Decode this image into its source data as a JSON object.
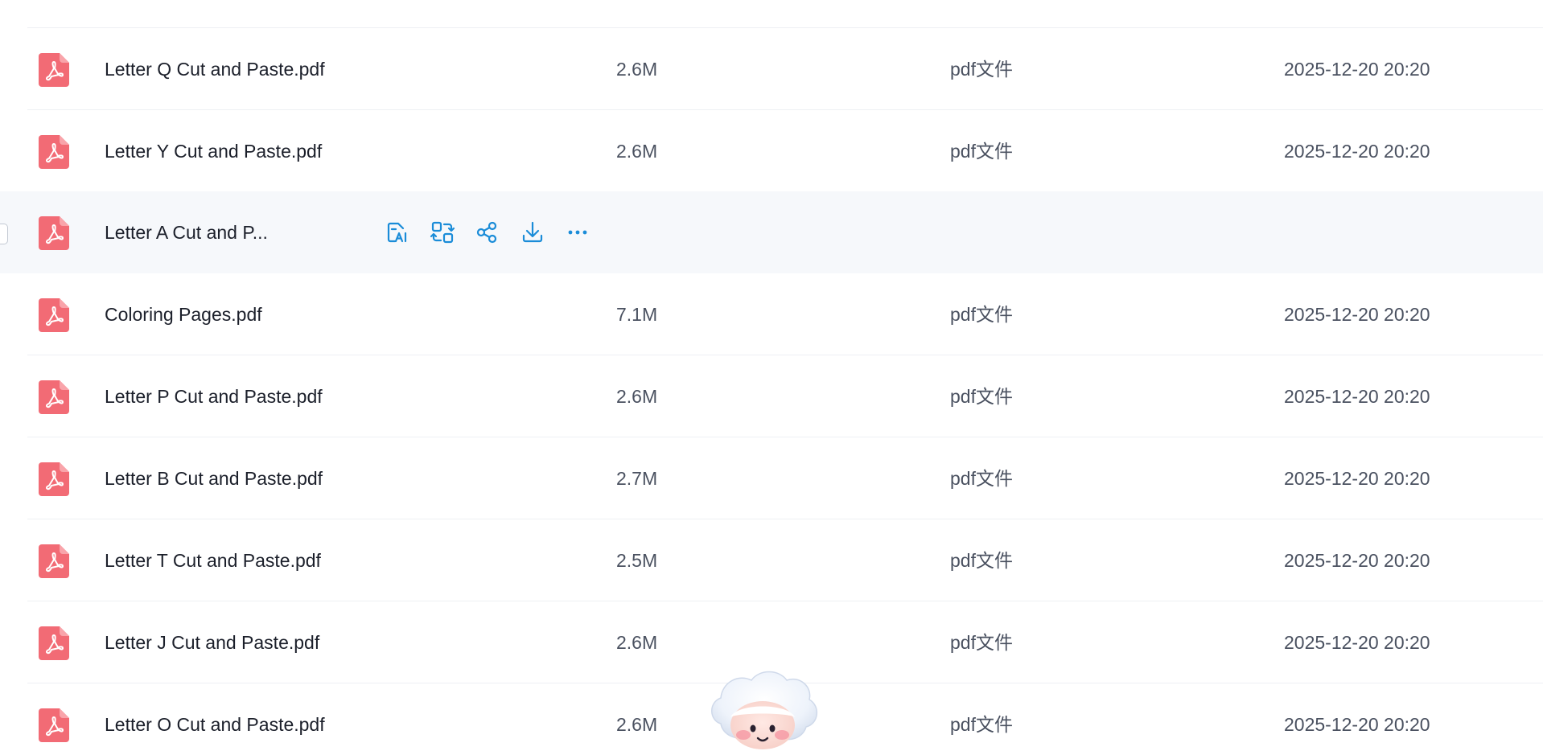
{
  "files": [
    {
      "name": "Letter Q Cut and Paste.pdf",
      "size": "2.6M",
      "type": "pdf文件",
      "date": "2025-12-20 20:20"
    },
    {
      "name": "Letter Y Cut and Paste.pdf",
      "size": "2.6M",
      "type": "pdf文件",
      "date": "2025-12-20 20:20"
    },
    {
      "name": "Letter A Cut and P...",
      "size": "",
      "type": "",
      "date": "",
      "hovered": true
    },
    {
      "name": "Coloring Pages.pdf",
      "size": "7.1M",
      "type": "pdf文件",
      "date": "2025-12-20 20:20"
    },
    {
      "name": "Letter P Cut and Paste.pdf",
      "size": "2.6M",
      "type": "pdf文件",
      "date": "2025-12-20 20:20"
    },
    {
      "name": "Letter B Cut and Paste.pdf",
      "size": "2.7M",
      "type": "pdf文件",
      "date": "2025-12-20 20:20"
    },
    {
      "name": "Letter T Cut and Paste.pdf",
      "size": "2.5M",
      "type": "pdf文件",
      "date": "2025-12-20 20:20"
    },
    {
      "name": "Letter J Cut and Paste.pdf",
      "size": "2.6M",
      "type": "pdf文件",
      "date": "2025-12-20 20:20"
    },
    {
      "name": "Letter O Cut and Paste.pdf",
      "size": "2.6M",
      "type": "pdf文件",
      "date": "2025-12-20 20:20"
    }
  ],
  "hover_actions": [
    "ai-summary-icon",
    "convert-icon",
    "share-icon",
    "download-icon",
    "more-icon"
  ],
  "colors": {
    "pdf_icon": "#f26b75",
    "action_icon": "#1a8cd8",
    "hover_row": "#f6f8fb"
  },
  "icons": {
    "file": "pdf-file-icon",
    "assistant": "assistant-mascot-icon"
  }
}
